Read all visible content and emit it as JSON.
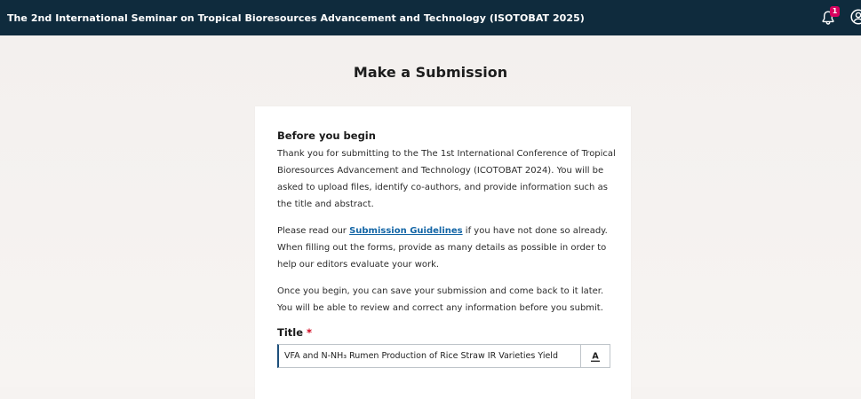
{
  "header": {
    "title": "The 2nd International Seminar on Tropical Bioresources Advancement and Technology (ISOTOBAT 2025)",
    "notification_count": "1",
    "icons": {
      "notifications": "bell-icon",
      "user": "user-circle-icon"
    }
  },
  "page": {
    "title": "Make a Submission"
  },
  "before_you_begin": {
    "heading": "Before you begin",
    "para1": "Thank you for submitting to the The 1st International Conference of Tropical Bioresources Advancement and Technology (ICOTOBAT 2024). You will be asked to upload files, identify co-authors, and provide information such as the title and abstract.",
    "para2_prefix": "Please read our ",
    "para2_link": "Submission Guidelines",
    "para2_suffix": " if you have not done so already. When filling out the forms, provide as many details as possible in order to help our editors evaluate your work.",
    "para3": "Once you begin, you can save your submission and come back to it later. You will be able to review and correct any information before you submit."
  },
  "title_field": {
    "label": "Title",
    "required_marker": "*",
    "value": "VFA and N-NH₃ Rumen Production of Rice Straw IR Varieties Yield",
    "format_button_label": "A"
  },
  "colors": {
    "header_bg": "#0f2b3d",
    "badge": "#d8005e",
    "link": "#1466a6",
    "required": "#d0021b",
    "input_accent": "#1d4f7b"
  }
}
